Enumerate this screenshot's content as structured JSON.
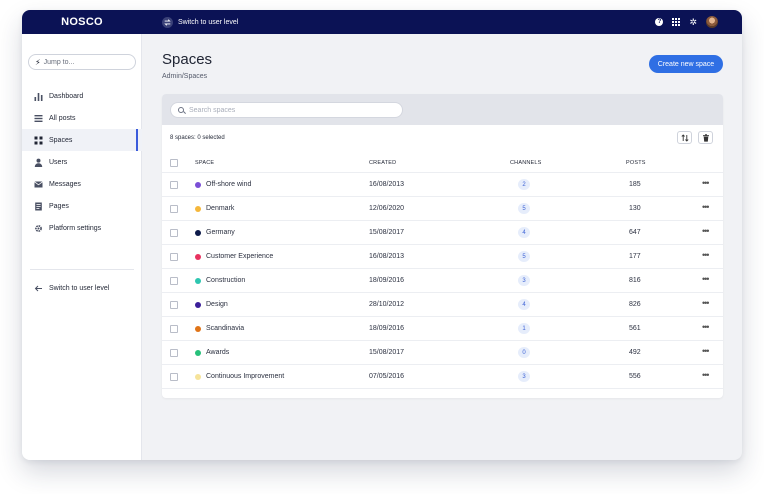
{
  "app": {
    "logo": "NOSCO",
    "switch_label": "Switch to user level",
    "help_glyph": "?"
  },
  "sidebar": {
    "jump_placeholder": "Jump to...",
    "items": [
      {
        "label": "Dashboard",
        "icon": "bar-chart-icon"
      },
      {
        "label": "All posts",
        "icon": "list-icon"
      },
      {
        "label": "Spaces",
        "icon": "spaces-grid-icon",
        "active": true
      },
      {
        "label": "Users",
        "icon": "user-icon"
      },
      {
        "label": "Messages",
        "icon": "envelope-icon"
      },
      {
        "label": "Pages",
        "icon": "page-icon"
      },
      {
        "label": "Platform settings",
        "icon": "gear-icon"
      }
    ],
    "switch_label": "Switch to user level"
  },
  "page": {
    "title": "Spaces",
    "breadcrumb": "Admin/Spaces",
    "create_button": "Create new space"
  },
  "table": {
    "search_placeholder": "Search spaces",
    "selection_summary": "8 spaces: 0 selected",
    "columns": {
      "space": "SPACE",
      "created": "CREATED",
      "channels": "CHANNELS",
      "posts": "POSTS"
    },
    "rows": [
      {
        "name": "Off-shore wind",
        "color": "#7b4fd6",
        "created": "16/08/2013",
        "channels": "2",
        "posts": "185"
      },
      {
        "name": "Denmark",
        "color": "#f5b73b",
        "created": "12/06/2020",
        "channels": "5",
        "posts": "130"
      },
      {
        "name": "Germany",
        "color": "#0d1a4a",
        "created": "15/08/2017",
        "channels": "4",
        "posts": "647"
      },
      {
        "name": "Customer Experience",
        "color": "#e8325f",
        "created": "16/08/2013",
        "channels": "5",
        "posts": "177"
      },
      {
        "name": "Construction",
        "color": "#2ec6b0",
        "created": "18/09/2016",
        "channels": "3",
        "posts": "816"
      },
      {
        "name": "Design",
        "color": "#3b1f9a",
        "created": "28/10/2012",
        "channels": "4",
        "posts": "826"
      },
      {
        "name": "Scandinavia",
        "color": "#e07418",
        "created": "18/09/2016",
        "channels": "1",
        "posts": "561"
      },
      {
        "name": "Awards",
        "color": "#27c07a",
        "created": "15/08/2017",
        "channels": "0",
        "posts": "492"
      },
      {
        "name": "Continuous Improvement",
        "color": "#f6e39a",
        "created": "07/05/2016",
        "channels": "3",
        "posts": "556"
      }
    ]
  }
}
